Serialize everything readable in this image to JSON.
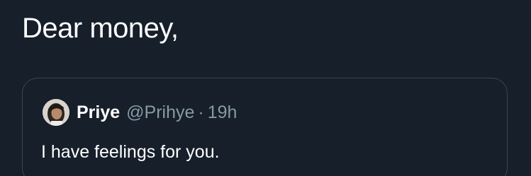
{
  "tweet": {
    "text": "Dear money,"
  },
  "quoted_tweet": {
    "author_name": "Priye",
    "author_handle": "@Prihye",
    "separator": "·",
    "timestamp": "19h",
    "text": "I have feelings for you.",
    "avatar_icon": "profile-photo"
  },
  "colors": {
    "background": "#161f2a",
    "card_border": "#3a4653",
    "primary_text": "#ffffff",
    "secondary_text": "#8899a6"
  }
}
